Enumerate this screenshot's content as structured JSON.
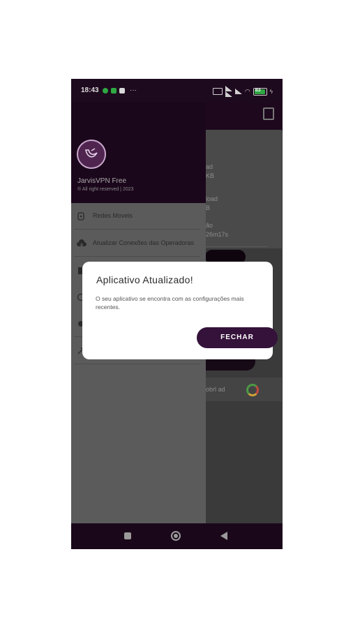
{
  "status_bar": {
    "time": "18:43",
    "more": "···",
    "battery": "83"
  },
  "app_behind": {
    "labels": [
      "ad",
      "KB",
      "load",
      "B",
      "ão",
      "26m17s",
      "obrl ad"
    ]
  },
  "drawer": {
    "app_name": "JarvisVPN Free",
    "copyright": "® All right reserved | 2023",
    "items": [
      {
        "label": "Redes Moveis",
        "icon": "mobile-network-icon"
      },
      {
        "label": "Atualizar Conexões das Operadoras",
        "icon": "cloud-download-icon"
      },
      {
        "label": "",
        "icon": "document-icon"
      },
      {
        "label": "",
        "icon": "info-icon"
      },
      {
        "label": "",
        "icon": "settings-icon"
      },
      {
        "label": "",
        "icon": "share-icon"
      }
    ]
  },
  "dialog": {
    "title": "Aplicativo Atualizado!",
    "message": "O seu aplicativo se encontra com as configurações mais recentes.",
    "button": "FECHAR"
  },
  "colors": {
    "accent": "#34123a",
    "header": "#1b071b",
    "scrim": "#5b5b5b"
  }
}
